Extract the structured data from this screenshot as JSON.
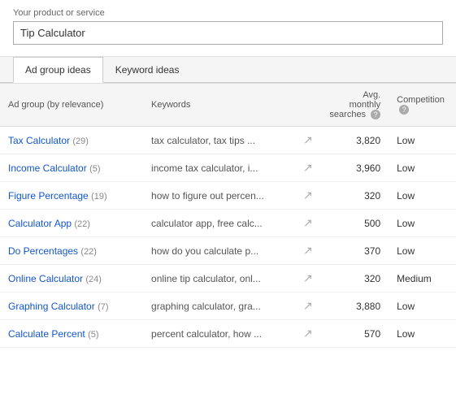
{
  "top": {
    "label": "Your product or service",
    "input_value": "Tip Calculator"
  },
  "tabs": [
    {
      "id": "ad-group-ideas",
      "label": "Ad group ideas",
      "active": true
    },
    {
      "id": "keyword-ideas",
      "label": "Keyword ideas",
      "active": false
    }
  ],
  "table": {
    "headers": {
      "ad_group": "Ad group (by relevance)",
      "keywords": "Keywords",
      "avg_monthly": "Avg. monthly searches",
      "competition": "Competition"
    },
    "rows": [
      {
        "ad_group": "Tax Calculator",
        "count": "(29)",
        "keywords": "tax calculator, tax tips ...",
        "monthly": "3,820",
        "competition": "Low"
      },
      {
        "ad_group": "Income Calculator",
        "count": "(5)",
        "keywords": "income tax calculator, i...",
        "monthly": "3,960",
        "competition": "Low"
      },
      {
        "ad_group": "Figure Percentage",
        "count": "(19)",
        "keywords": "how to figure out percen...",
        "monthly": "320",
        "competition": "Low"
      },
      {
        "ad_group": "Calculator App",
        "count": "(22)",
        "keywords": "calculator app, free calc...",
        "monthly": "500",
        "competition": "Low"
      },
      {
        "ad_group": "Do Percentages",
        "count": "(22)",
        "keywords": "how do you calculate p...",
        "monthly": "370",
        "competition": "Low"
      },
      {
        "ad_group": "Online Calculator",
        "count": "(24)",
        "keywords": "online tip calculator, onl...",
        "monthly": "320",
        "competition": "Medium"
      },
      {
        "ad_group": "Graphing Calculator",
        "count": "(7)",
        "keywords": "graphing calculator, gra...",
        "monthly": "3,880",
        "competition": "Low"
      },
      {
        "ad_group": "Calculate Percent",
        "count": "(5)",
        "keywords": "percent calculator, how ...",
        "monthly": "570",
        "competition": "Low"
      }
    ]
  }
}
